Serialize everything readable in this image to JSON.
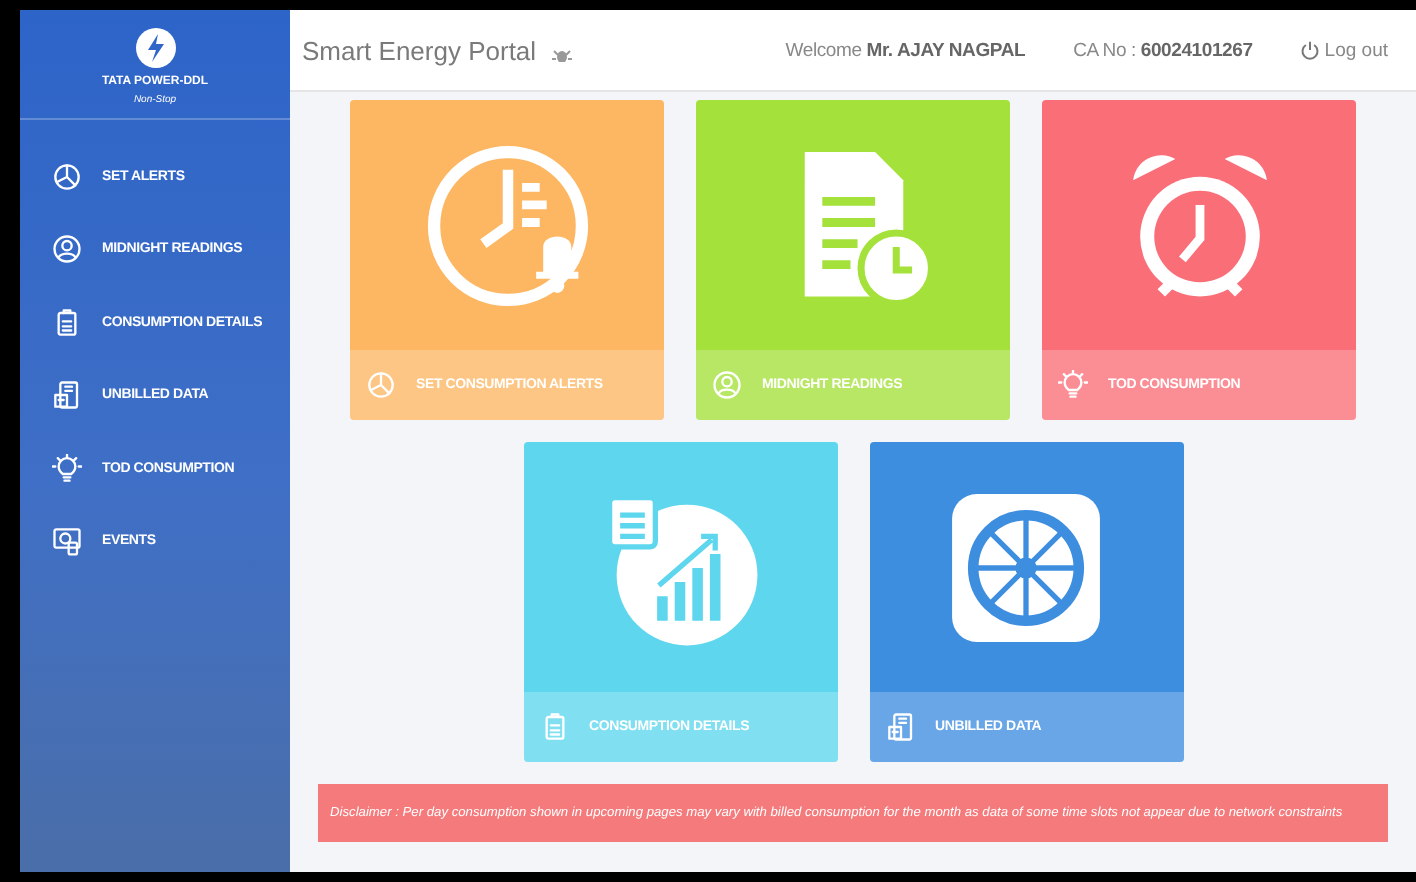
{
  "sidebar": {
    "brand": "TATA POWER-DDL",
    "tagline": "Non-Stop",
    "items": [
      {
        "label": "SET ALERTS",
        "kind": "pie"
      },
      {
        "label": "MIDNIGHT READINGS",
        "kind": "user"
      },
      {
        "label": "CONSUMPTION DETAILS",
        "kind": "clipboard"
      },
      {
        "label": "UNBILLED DATA",
        "kind": "calculator"
      },
      {
        "label": "TOD CONSUMPTION",
        "kind": "bulb"
      },
      {
        "label": "EVENTS",
        "kind": "events"
      }
    ]
  },
  "header": {
    "title": "Smart Energy Portal",
    "welcome": "Welcome",
    "user": "Mr. AJAY NAGPAL",
    "ca_label": "CA No :",
    "ca_number": "60024101267",
    "logout": "Log out"
  },
  "tile_rows": [
    [
      {
        "label": "SET CONSUMPTION ALERTS",
        "kind": "alerts",
        "color": "#fdb662"
      },
      {
        "label": "MIDNIGHT READINGS",
        "kind": "midnight",
        "color": "#a4e13a"
      },
      {
        "label": "TOD CONSUMPTION",
        "kind": "tod",
        "color": "#fa6e78"
      }
    ],
    [
      {
        "label": "CONSUMPTION DETAILS",
        "kind": "details",
        "color": "#5dd6ee"
      },
      {
        "label": "UNBILLED DATA",
        "kind": "unbilled",
        "color": "#3e8ee0"
      }
    ]
  ],
  "disclaimer": "Disclaimer : Per day consumption shown in upcoming pages may vary with billed consumption for the month as data of some time slots not appear due to network constraints"
}
